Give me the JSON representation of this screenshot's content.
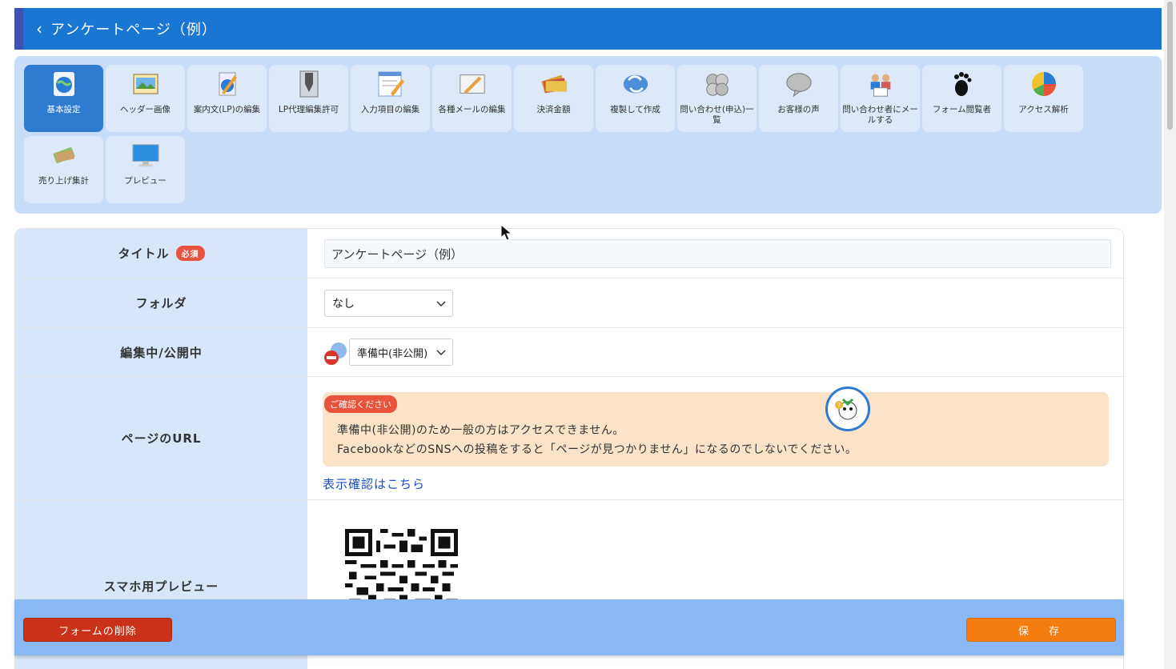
{
  "header": {
    "back_icon": "chevron-left-icon",
    "back_glyph": "‹",
    "title": "アンケートページ（例）"
  },
  "toolbar": {
    "items": [
      {
        "label": "基本設定",
        "icon": "globe-icon",
        "active": true
      },
      {
        "label": "ヘッダー画像",
        "icon": "image-icon"
      },
      {
        "label": "案内文(LP)の編集",
        "icon": "pencil-doc-icon"
      },
      {
        "label": "LP代理編集許可",
        "icon": "pen-nib-icon"
      },
      {
        "label": "入力項目の編集",
        "icon": "edit-form-icon"
      },
      {
        "label": "各種メールの編集",
        "icon": "mail-edit-icon"
      },
      {
        "label": "決済金額",
        "icon": "credit-card-icon"
      },
      {
        "label": "複製して作成",
        "icon": "duplicate-icon"
      },
      {
        "label": "問い合わせ(申込)一覧",
        "icon": "inquiry-list-icon"
      },
      {
        "label": "お客様の声",
        "icon": "speech-bubble-icon"
      },
      {
        "label": "問い合わせ者にメールする",
        "icon": "mail-people-icon"
      },
      {
        "label": "フォーム閲覧者",
        "icon": "footprint-icon"
      },
      {
        "label": "アクセス解析",
        "icon": "pie-chart-icon"
      },
      {
        "label": "売り上げ集計",
        "icon": "money-icon"
      },
      {
        "label": "プレビュー",
        "icon": "monitor-icon"
      }
    ]
  },
  "form": {
    "title": {
      "label": "タイトル",
      "required": "必須",
      "value": "アンケートページ（例）"
    },
    "folder": {
      "label": "フォルダ",
      "value": "なし"
    },
    "status": {
      "label": "編集中/公開中",
      "value": "準備中(非公開)"
    },
    "url": {
      "label": "ページのURL",
      "notice_tag": "ご確認ください",
      "notice_line1": "準備中(非公開)のため一般の方はアクセスできません。",
      "notice_line2": "FacebookなどのSNSへの投稿をすると「ページが見つかりません」になるのでしないでください。",
      "link": "表示確認はこちら"
    },
    "preview": {
      "label": "スマホ用プレビュー"
    }
  },
  "actions": {
    "delete": "フォームの削除",
    "save": "保　存"
  },
  "colors": {
    "header": "#1976d2",
    "toolbar": "#c9ddf8",
    "label_bg": "#d7e6f8",
    "delete": "#c93218",
    "save": "#f57c0e",
    "notice": "#fbe3c8"
  }
}
